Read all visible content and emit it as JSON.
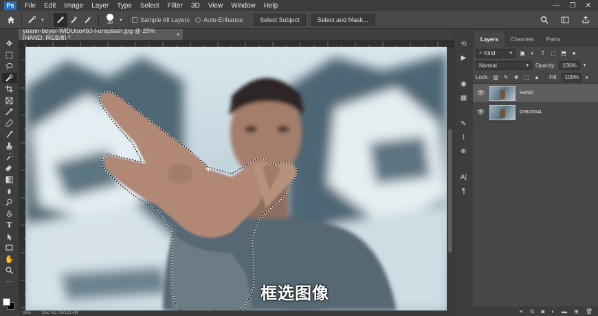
{
  "app": {
    "logo": "Ps"
  },
  "menu": [
    "File",
    "Edit",
    "Image",
    "Layer",
    "Type",
    "Select",
    "Filter",
    "3D",
    "View",
    "Window",
    "Help"
  ],
  "window_controls": {
    "minimize": "—",
    "restore": "❐",
    "close": "✕"
  },
  "options_bar": {
    "brush_size": "30",
    "sample_all_layers": "Sample All Layers",
    "auto_enhance": "Auto-Enhance",
    "select_subject": "Select Subject",
    "select_and_mask": "Select and Mask..."
  },
  "document": {
    "tab_title": "yoann-boyer-WlDUoo49J-I-unsplash.jpg @ 25% (HAND, RGB/8) *",
    "tab_close": "×"
  },
  "status": {
    "zoom": "25%",
    "doc": "Doc: 61.7M/123.4M"
  },
  "caption": "框选图像",
  "panel": {
    "tabs": [
      "Layers",
      "Channels",
      "Paths"
    ],
    "kind_label": "Kind",
    "blend_mode": "Normal",
    "opacity_label": "Opacity:",
    "opacity_value": "100%",
    "lock_label": "Lock:",
    "fill_label": "Fill:",
    "fill_value": "100%",
    "layers": [
      {
        "name": "HAND",
        "selected": true
      },
      {
        "name": "ORIGINAL",
        "selected": false
      }
    ]
  },
  "icons": {
    "home": "home-icon",
    "search": "search-icon",
    "workspace": "workspace-icon",
    "share": "share-icon"
  }
}
